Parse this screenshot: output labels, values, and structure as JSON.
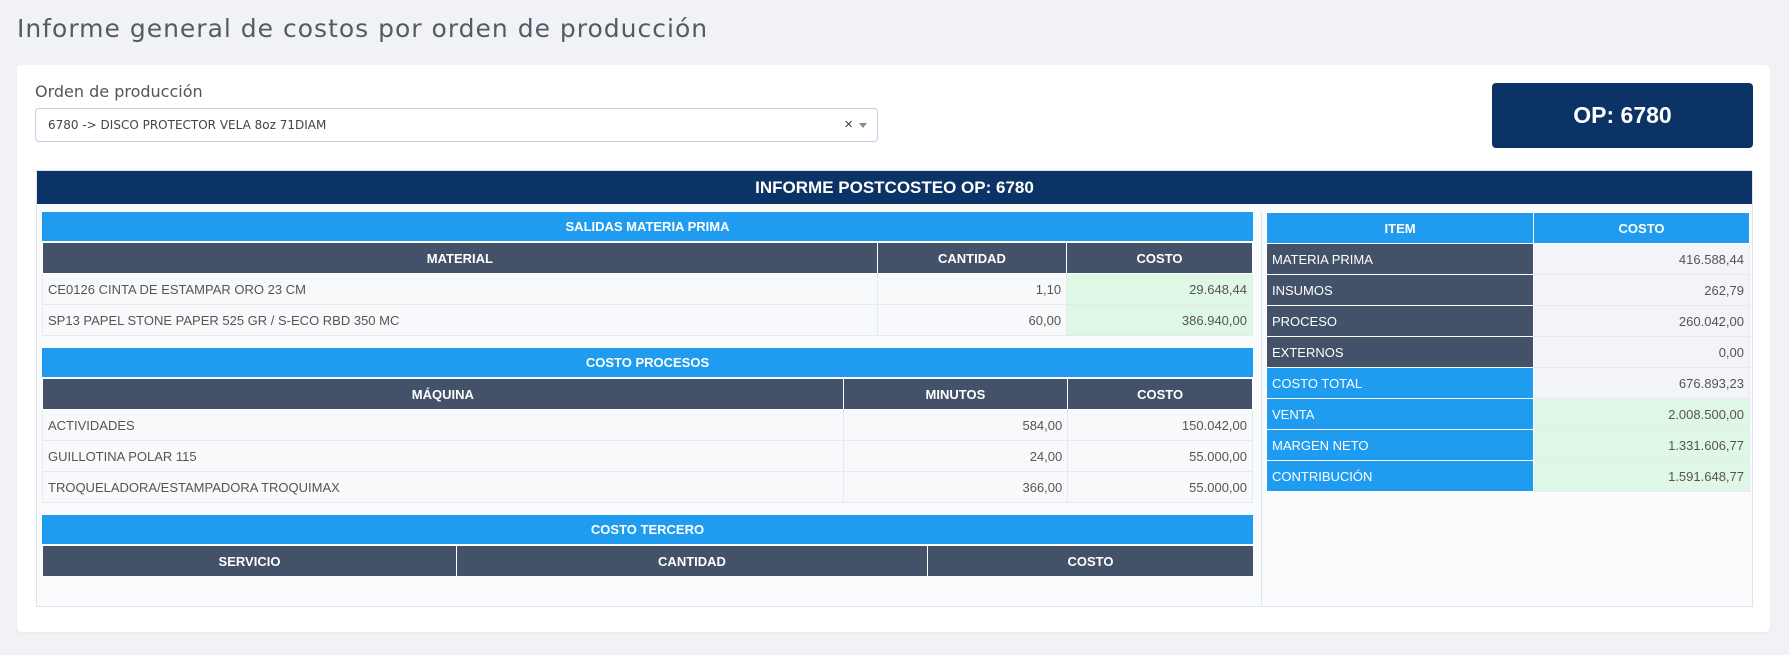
{
  "page": {
    "title": "Informe general de costos por orden de producción"
  },
  "selector": {
    "label": "Orden de producción",
    "value": "6780 -> DISCO PROTECTOR VELA 8oz 71DIAM",
    "clear": "×"
  },
  "badge": {
    "text": "OP: 6780"
  },
  "report": {
    "title": "INFORME POSTCOSTEO OP: 6780",
    "materia_prima": {
      "title": "SALIDAS MATERIA PRIMA",
      "headers": [
        "MATERIAL",
        "CANTIDAD",
        "COSTO"
      ],
      "rows": [
        [
          "CE0126 CINTA DE ESTAMPAR ORO 23 CM",
          "1,10",
          "29.648,44"
        ],
        [
          "SP13 PAPEL STONE PAPER 525 GR / S-ECO RBD 350 MC",
          "60,00",
          "386.940,00"
        ]
      ]
    },
    "procesos": {
      "title": "COSTO PROCESOS",
      "headers": [
        "MÁQUINA",
        "MINUTOS",
        "COSTO"
      ],
      "rows": [
        [
          "ACTIVIDADES",
          "584,00",
          "150.042,00"
        ],
        [
          "GUILLOTINA POLAR 115",
          "24,00",
          "55.000,00"
        ],
        [
          "TROQUELADORA/ESTAMPADORA TROQUIMAX",
          "366,00",
          "55.000,00"
        ]
      ]
    },
    "tercero": {
      "title": "COSTO TERCERO",
      "headers": [
        "SERVICIO",
        "CANTIDAD",
        "COSTO"
      ]
    },
    "summary": {
      "headers": [
        "ITEM",
        "COSTO"
      ],
      "rows": [
        [
          "MATERIA PRIMA",
          "416.588,44"
        ],
        [
          "INSUMOS",
          "262,79"
        ],
        [
          "PROCESO",
          "260.042,00"
        ],
        [
          "EXTERNOS",
          "0,00"
        ],
        [
          "COSTO TOTAL",
          "676.893,23"
        ],
        [
          "VENTA",
          "2.008.500,00"
        ],
        [
          "MARGEN NETO",
          "1.331.606,77"
        ],
        [
          "CONTRIBUCIÓN",
          "1.591.648,77"
        ]
      ]
    }
  }
}
